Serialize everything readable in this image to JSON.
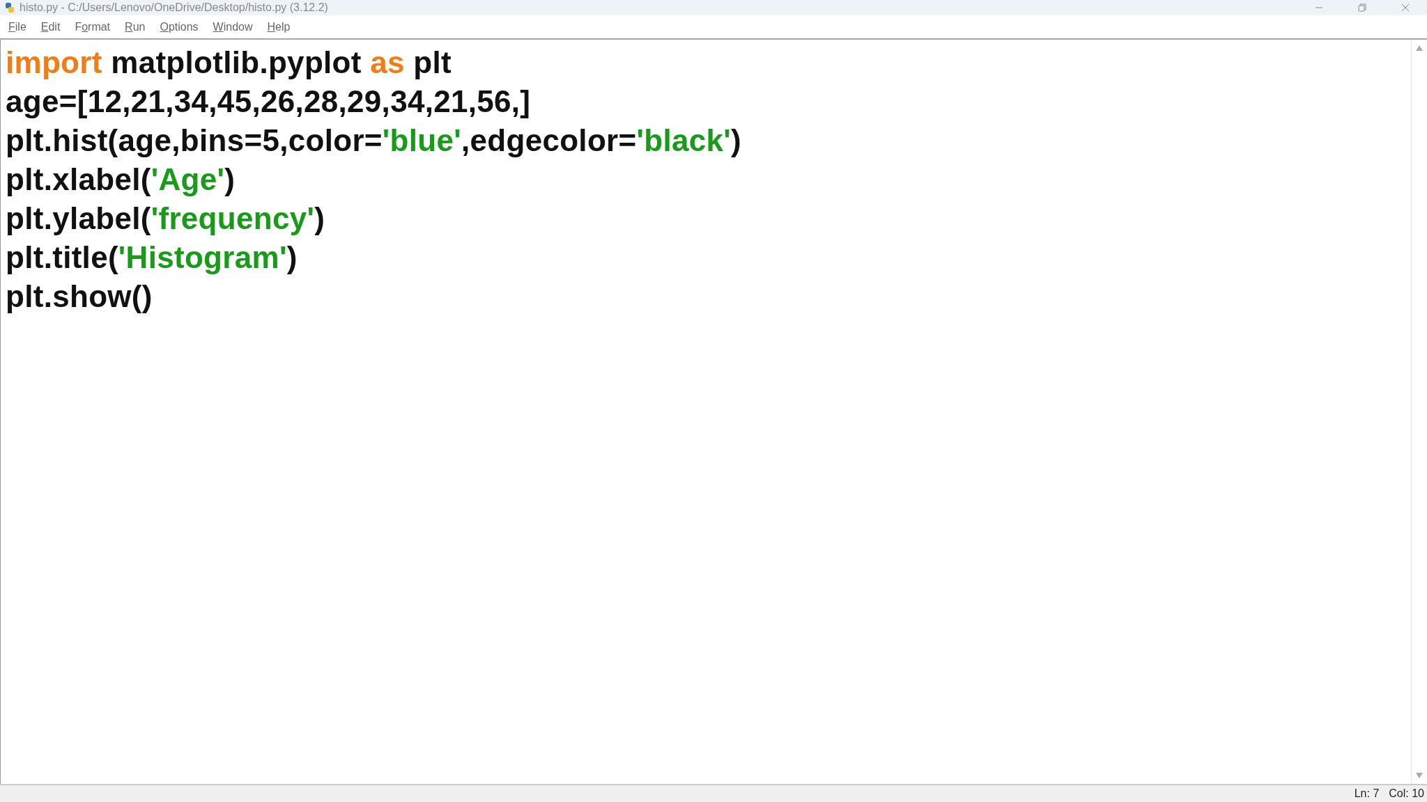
{
  "window": {
    "title": "histo.py - C:/Users/Lenovo/OneDrive/Desktop/histo.py (3.12.2)"
  },
  "menu": [
    {
      "key": "F",
      "after": "ile"
    },
    {
      "key": "E",
      "after": "dit"
    },
    {
      "before": "F",
      "key": "o",
      "after": "rmat"
    },
    {
      "key": "R",
      "after": "un"
    },
    {
      "key": "O",
      "after": "ptions"
    },
    {
      "key": "W",
      "after": "indow"
    },
    {
      "key": "H",
      "after": "elp"
    }
  ],
  "editor": {
    "lines": [
      [
        {
          "kind": "keyword",
          "text": "import"
        },
        {
          "kind": "plain",
          "text": " matplotlib.pyplot "
        },
        {
          "kind": "keyword",
          "text": "as"
        },
        {
          "kind": "plain",
          "text": " plt"
        }
      ],
      [
        {
          "kind": "plain",
          "text": "age=[12,21,34,45,26,28,29,34,21,56,]"
        }
      ],
      [
        {
          "kind": "plain",
          "text": "plt.hist(age,bins=5,color="
        },
        {
          "kind": "string",
          "text": "'blue'"
        },
        {
          "kind": "plain",
          "text": ",edgecolor="
        },
        {
          "kind": "string",
          "text": "'black'"
        },
        {
          "kind": "plain",
          "text": ")"
        }
      ],
      [
        {
          "kind": "plain",
          "text": "plt.xlabel("
        },
        {
          "kind": "string",
          "text": "'Age'"
        },
        {
          "kind": "plain",
          "text": ")"
        }
      ],
      [
        {
          "kind": "plain",
          "text": "plt.ylabel("
        },
        {
          "kind": "string",
          "text": "'frequency'"
        },
        {
          "kind": "plain",
          "text": ")"
        }
      ],
      [
        {
          "kind": "plain",
          "text": "plt.title("
        },
        {
          "kind": "string",
          "text": "'Histogram'"
        },
        {
          "kind": "plain",
          "text": ")"
        }
      ],
      [
        {
          "kind": "plain",
          "text": "plt.show()"
        }
      ]
    ]
  },
  "status_bar": {
    "line": "Ln: 7",
    "column": "Col: 10"
  }
}
